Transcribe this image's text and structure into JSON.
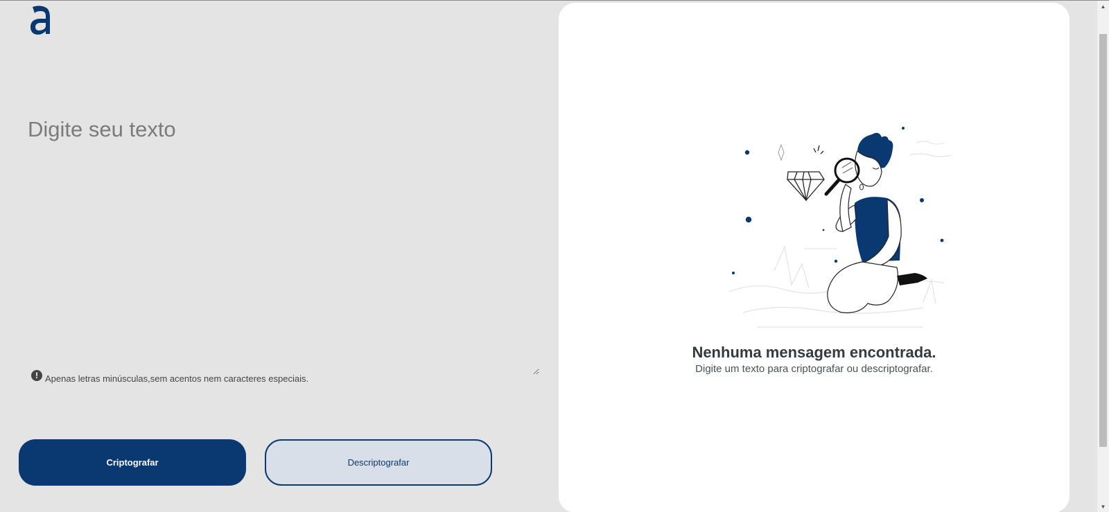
{
  "logo": {
    "icon": "alura-a-logo-icon",
    "color": "#0a3871"
  },
  "input": {
    "placeholder": "Digite seu texto",
    "value": ""
  },
  "hint": {
    "icon": "exclamation-icon",
    "text": "Apenas letras minúsculas,sem acentos nem caracteres especiais."
  },
  "buttons": {
    "encrypt_label": "Criptografar",
    "decrypt_label": "Descriptografar"
  },
  "output": {
    "title": "Nenhuma mensagem encontrada.",
    "subtitle": "Digite um texto para criptografar ou descriptografar.",
    "illustration": "person-with-magnifying-glass-diamond-illustration"
  },
  "colors": {
    "accent": "#0a3871",
    "background": "#e4e4e4",
    "panel": "#ffffff",
    "secondary_button": "#d8dfe8"
  }
}
